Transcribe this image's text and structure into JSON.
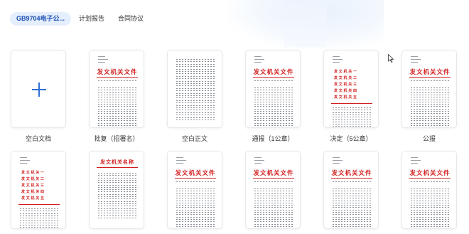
{
  "tabs": [
    {
      "label": "GB9704电子公...",
      "active": true
    },
    {
      "label": "计划报告",
      "active": false
    },
    {
      "label": "合同协议",
      "active": false
    }
  ],
  "templates_row1": [
    {
      "label": "空白文档",
      "kind": "blank"
    },
    {
      "label": "批复（招署名）",
      "kind": "red-head"
    },
    {
      "label": "空白正文",
      "kind": "plain"
    },
    {
      "label": "通报（1公章）",
      "kind": "red-head"
    },
    {
      "label": "决定（5公章）",
      "kind": "multi-red"
    },
    {
      "label": "公报",
      "kind": "red-head"
    }
  ],
  "templates_row2": [
    {
      "label": "",
      "kind": "multi-red"
    },
    {
      "label": "",
      "kind": "name-head"
    },
    {
      "label": "",
      "kind": "red-head"
    },
    {
      "label": "",
      "kind": "red-head"
    },
    {
      "label": "",
      "kind": "red-head"
    },
    {
      "label": "",
      "kind": "red-head"
    }
  ],
  "doc_head_title": "发文机关文件",
  "doc_head_title_alt": "发文机关名称",
  "doc_multi_lines": [
    "发 文 机 关 一",
    "发 文 机 关 二",
    "发 文 机 关 三",
    "发 文 机 关 四",
    "发 文 机 关 五"
  ],
  "colors": {
    "accent": "#2e6fd9",
    "red": "#d21e1e",
    "tab_active_bg": "#e4eefc"
  }
}
